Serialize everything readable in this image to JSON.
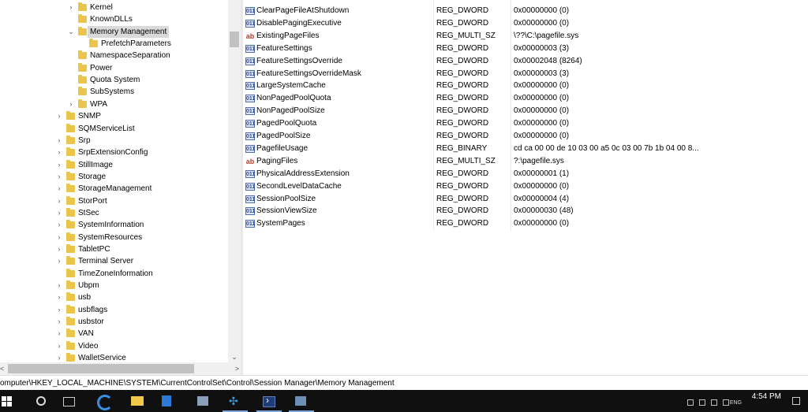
{
  "tree": {
    "items": [
      {
        "label": "Kernel",
        "level": 2,
        "expand": "›"
      },
      {
        "label": "KnownDLLs",
        "level": 2,
        "expand": ""
      },
      {
        "label": "Memory Management",
        "level": 2,
        "expand": "⌄",
        "selected": true
      },
      {
        "label": "PrefetchParameters",
        "level": 3,
        "expand": ""
      },
      {
        "label": "NamespaceSeparation",
        "level": 2,
        "expand": ""
      },
      {
        "label": "Power",
        "level": 2,
        "expand": ""
      },
      {
        "label": "Quota System",
        "level": 2,
        "expand": ""
      },
      {
        "label": "SubSystems",
        "level": 2,
        "expand": ""
      },
      {
        "label": "WPA",
        "level": 2,
        "expand": "›"
      },
      {
        "label": "SNMP",
        "level": 1,
        "expand": "›"
      },
      {
        "label": "SQMServiceList",
        "level": 1,
        "expand": ""
      },
      {
        "label": "Srp",
        "level": 1,
        "expand": "›"
      },
      {
        "label": "SrpExtensionConfig",
        "level": 1,
        "expand": "›"
      },
      {
        "label": "StillImage",
        "level": 1,
        "expand": "›"
      },
      {
        "label": "Storage",
        "level": 1,
        "expand": "›"
      },
      {
        "label": "StorageManagement",
        "level": 1,
        "expand": "›"
      },
      {
        "label": "StorPort",
        "level": 1,
        "expand": "›"
      },
      {
        "label": "StSec",
        "level": 1,
        "expand": "›"
      },
      {
        "label": "SystemInformation",
        "level": 1,
        "expand": "›"
      },
      {
        "label": "SystemResources",
        "level": 1,
        "expand": "›"
      },
      {
        "label": "TabletPC",
        "level": 1,
        "expand": "›"
      },
      {
        "label": "Terminal Server",
        "level": 1,
        "expand": "›"
      },
      {
        "label": "TimeZoneInformation",
        "level": 1,
        "expand": ""
      },
      {
        "label": "Ubpm",
        "level": 1,
        "expand": "›"
      },
      {
        "label": "usb",
        "level": 1,
        "expand": "›"
      },
      {
        "label": "usbflags",
        "level": 1,
        "expand": "›"
      },
      {
        "label": "usbstor",
        "level": 1,
        "expand": "›"
      },
      {
        "label": "VAN",
        "level": 1,
        "expand": "›"
      },
      {
        "label": "Video",
        "level": 1,
        "expand": "›"
      },
      {
        "label": "WalletService",
        "level": 1,
        "expand": "›"
      }
    ],
    "scroll_down_icon": "chevron-down-icon"
  },
  "values": {
    "rows": [
      {
        "name": "ClearPageFileAtShutdown",
        "type": "REG_DWORD",
        "data": "0x00000000 (0)",
        "icon": "dword"
      },
      {
        "name": "DisablePagingExecutive",
        "type": "REG_DWORD",
        "data": "0x00000000 (0)",
        "icon": "dword"
      },
      {
        "name": "ExistingPageFiles",
        "type": "REG_MULTI_SZ",
        "data": "\\??\\C:\\pagefile.sys",
        "icon": "str"
      },
      {
        "name": "FeatureSettings",
        "type": "REG_DWORD",
        "data": "0x00000003 (3)",
        "icon": "dword"
      },
      {
        "name": "FeatureSettingsOverride",
        "type": "REG_DWORD",
        "data": "0x00002048 (8264)",
        "icon": "dword"
      },
      {
        "name": "FeatureSettingsOverrideMask",
        "type": "REG_DWORD",
        "data": "0x00000003 (3)",
        "icon": "dword"
      },
      {
        "name": "LargeSystemCache",
        "type": "REG_DWORD",
        "data": "0x00000000 (0)",
        "icon": "dword"
      },
      {
        "name": "NonPagedPoolQuota",
        "type": "REG_DWORD",
        "data": "0x00000000 (0)",
        "icon": "dword"
      },
      {
        "name": "NonPagedPoolSize",
        "type": "REG_DWORD",
        "data": "0x00000000 (0)",
        "icon": "dword"
      },
      {
        "name": "PagedPoolQuota",
        "type": "REG_DWORD",
        "data": "0x00000000 (0)",
        "icon": "dword"
      },
      {
        "name": "PagedPoolSize",
        "type": "REG_DWORD",
        "data": "0x00000000 (0)",
        "icon": "dword"
      },
      {
        "name": "PagefileUsage",
        "type": "REG_BINARY",
        "data": "cd ca 00 00 de 10 03 00 a5 0c 03 00 7b 1b 04 00 8...",
        "icon": "dword"
      },
      {
        "name": "PagingFiles",
        "type": "REG_MULTI_SZ",
        "data": "?:\\pagefile.sys",
        "icon": "str"
      },
      {
        "name": "PhysicalAddressExtension",
        "type": "REG_DWORD",
        "data": "0x00000001 (1)",
        "icon": "dword"
      },
      {
        "name": "SecondLevelDataCache",
        "type": "REG_DWORD",
        "data": "0x00000000 (0)",
        "icon": "dword"
      },
      {
        "name": "SessionPoolSize",
        "type": "REG_DWORD",
        "data": "0x00000004 (4)",
        "icon": "dword"
      },
      {
        "name": "SessionViewSize",
        "type": "REG_DWORD",
        "data": "0x00000030 (48)",
        "icon": "dword"
      },
      {
        "name": "SystemPages",
        "type": "REG_DWORD",
        "data": "0x00000000 (0)",
        "icon": "dword"
      }
    ],
    "icon_text": {
      "dword": "011",
      "str": "ab"
    }
  },
  "statusbar": {
    "path": "omputer\\HKEY_LOCAL_MACHINE\\SYSTEM\\CurrentControlSet\\Control\\Session Manager\\Memory Management"
  },
  "taskbar": {
    "icons": [
      "windows-start-icon",
      "search-icon",
      "task-view-icon",
      "edge-icon",
      "file-explorer-icon",
      "store-icon",
      "server-manager-icon",
      "regedit-icon",
      "powershell-icon",
      "remote-desktop-icon"
    ],
    "tray": {
      "language": "ENG",
      "time": "4:54 PM"
    }
  },
  "colors": {
    "selected_bg": "#d9d9d9",
    "folder": "#e9c54c",
    "taskbar_bg": "#101010"
  }
}
